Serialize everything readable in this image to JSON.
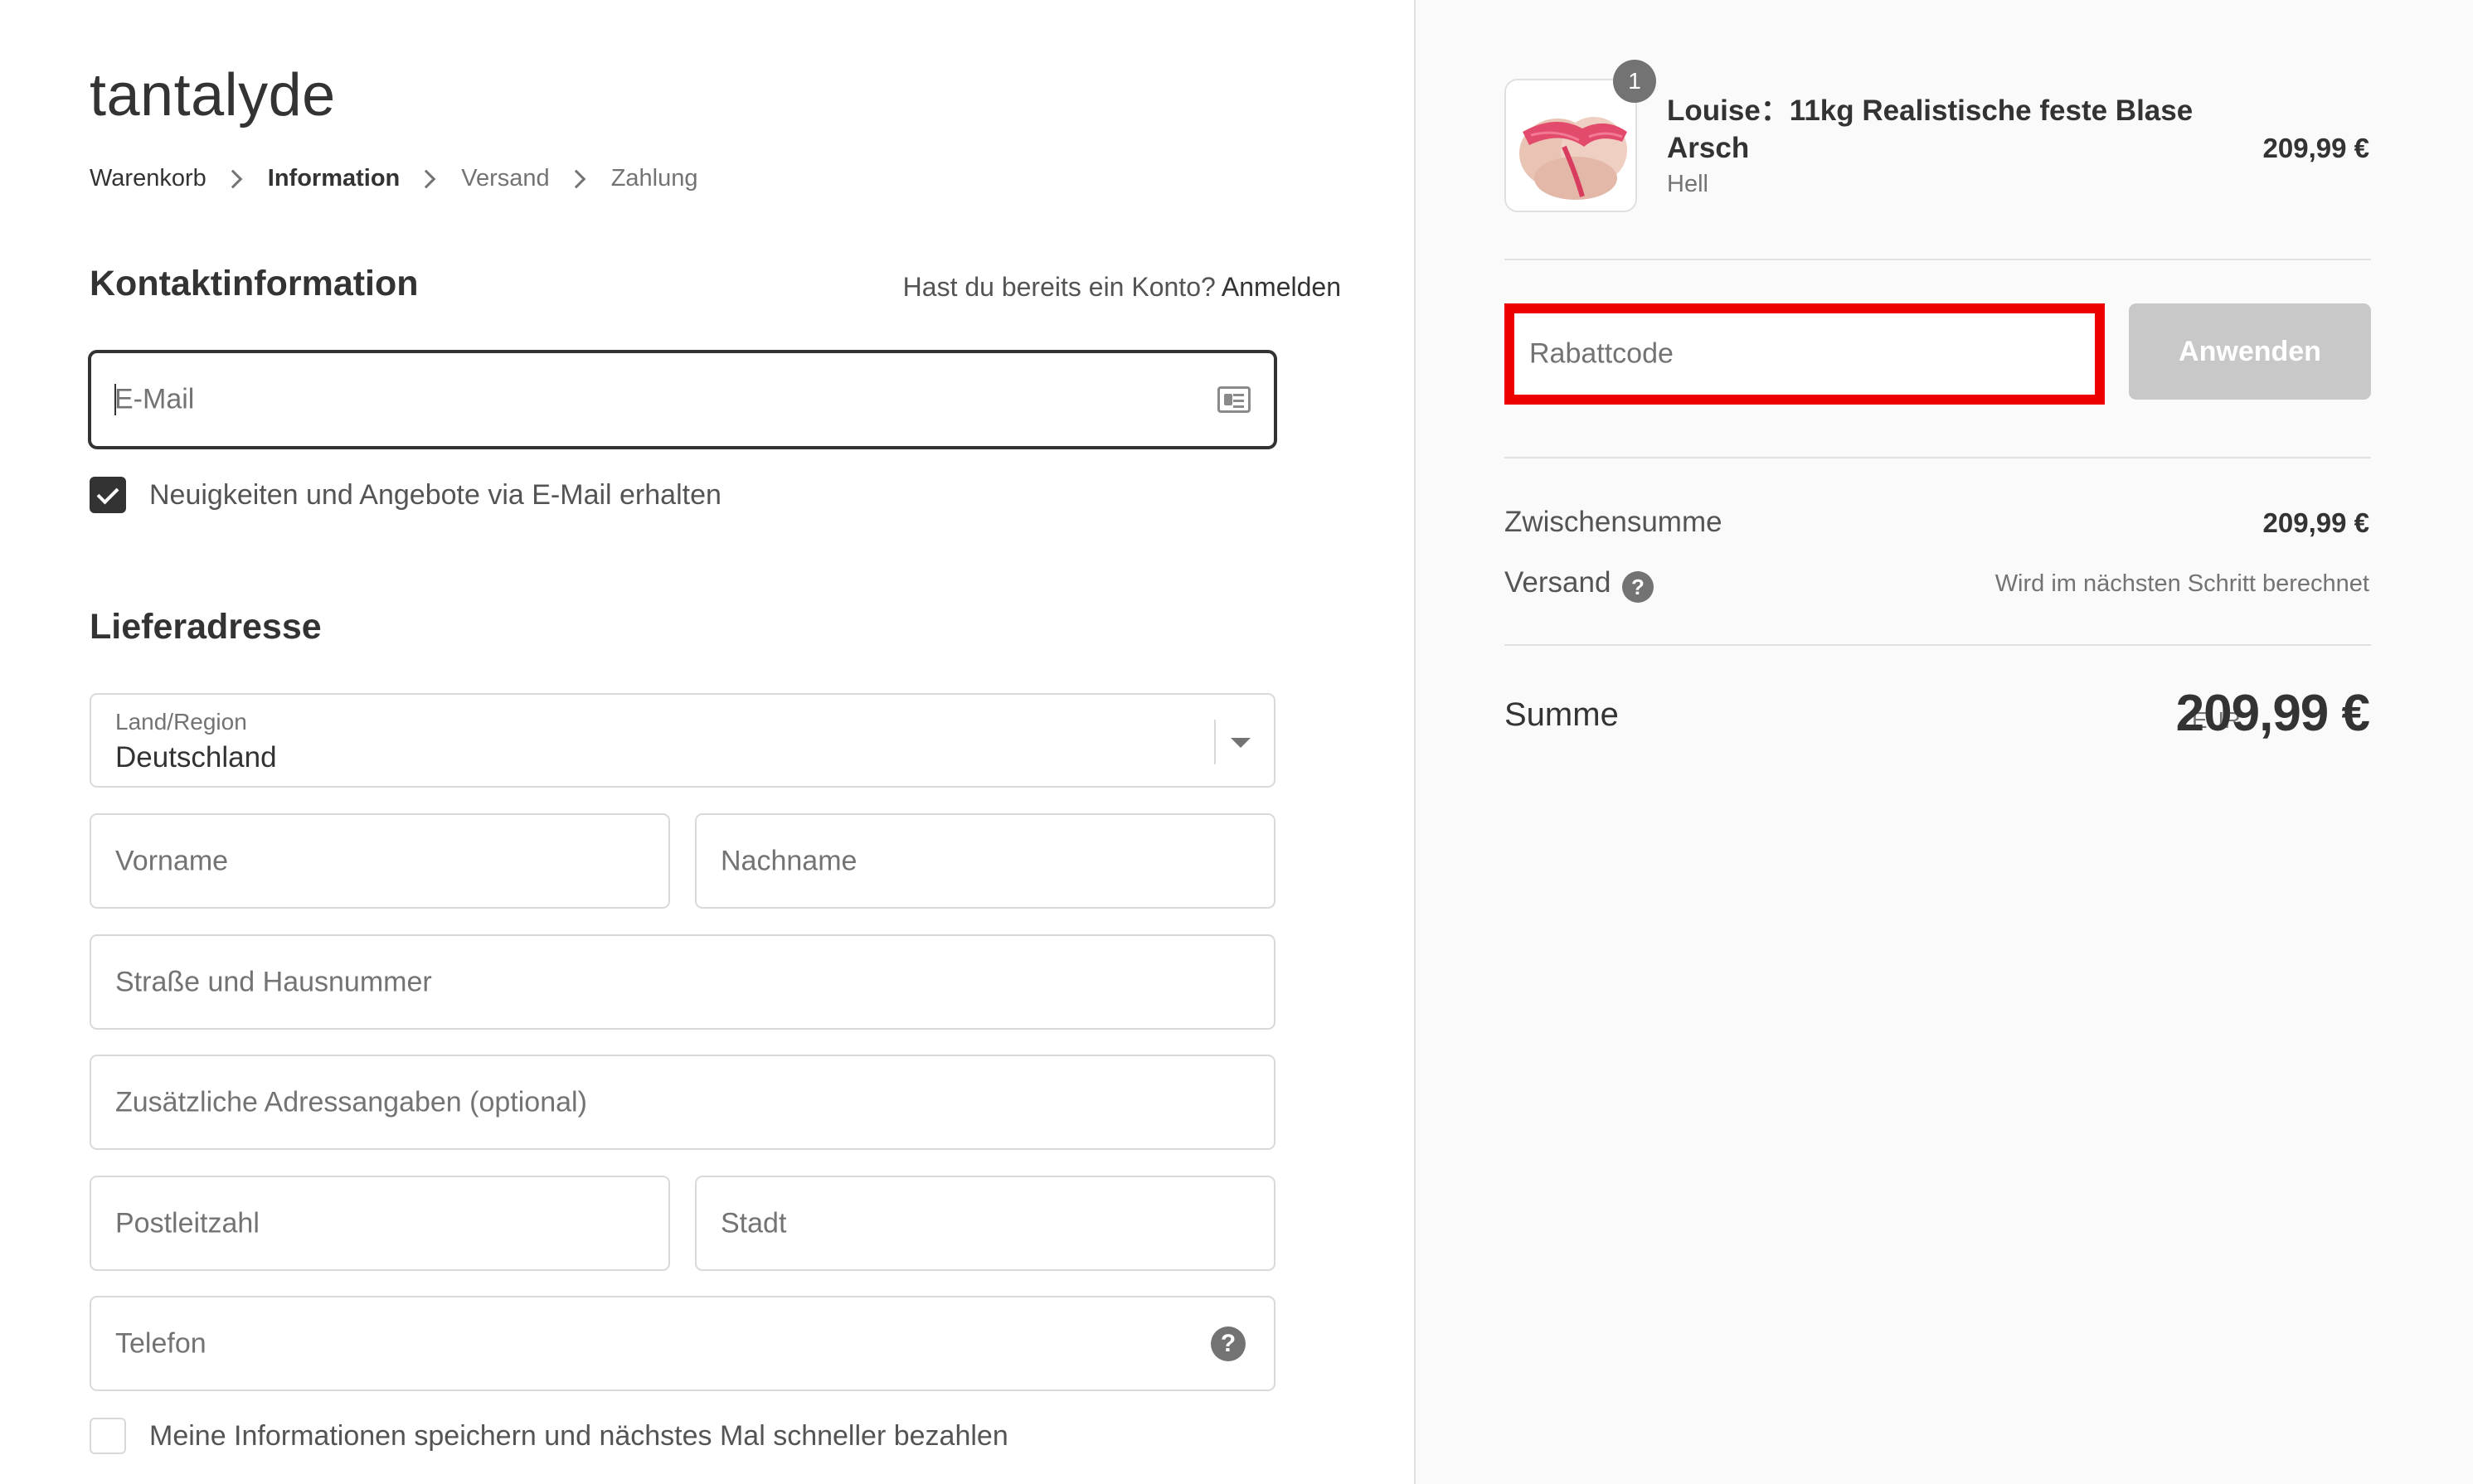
{
  "store": {
    "name": "tantalyde"
  },
  "breadcrumb": [
    "Warenkorb",
    "Information",
    "Versand",
    "Zahlung"
  ],
  "contact": {
    "title": "Kontaktinformation",
    "account_question": "Hast du bereits ein Konto?",
    "login_link": "Anmelden",
    "email_placeholder": "E-Mail",
    "newsletter_label": "Neuigkeiten und Angebote via E-Mail erhalten",
    "newsletter_checked": true
  },
  "shipping": {
    "title": "Lieferadresse",
    "country_label": "Land/Region",
    "country_value": "Deutschland",
    "first_name_placeholder": "Vorname",
    "last_name_placeholder": "Nachname",
    "street_placeholder": "Straße und Hausnummer",
    "address2_placeholder": "Zusätzliche Adressangaben (optional)",
    "postal_placeholder": "Postleitzahl",
    "city_placeholder": "Stadt",
    "phone_placeholder": "Telefon",
    "phone_help": "?",
    "save_info_label": "Meine Informationen speichern und nächstes Mal schneller bezahlen",
    "save_info_checked": false
  },
  "summary": {
    "product": {
      "quantity": "1",
      "name": "Louise：11kg Realistische feste Blase Arsch",
      "variant": "Hell",
      "price": "209,99 €"
    },
    "discount_placeholder": "Rabattcode",
    "apply_label": "Anwenden",
    "subtotal_label": "Zwischensumme",
    "subtotal_value": "209,99 €",
    "shipping_label": "Versand",
    "shipping_help": "?",
    "shipping_value": "Wird im nächsten Schritt berechnet",
    "total_label": "Summe",
    "total_currency": "EUR",
    "total_value": "209,99 €"
  },
  "colors": {
    "highlight_border": "#ee0000",
    "checkbox_fill": "#333333",
    "apply_button_disabled": "#c8c8c8",
    "sidebar_background": "#fafafa"
  }
}
